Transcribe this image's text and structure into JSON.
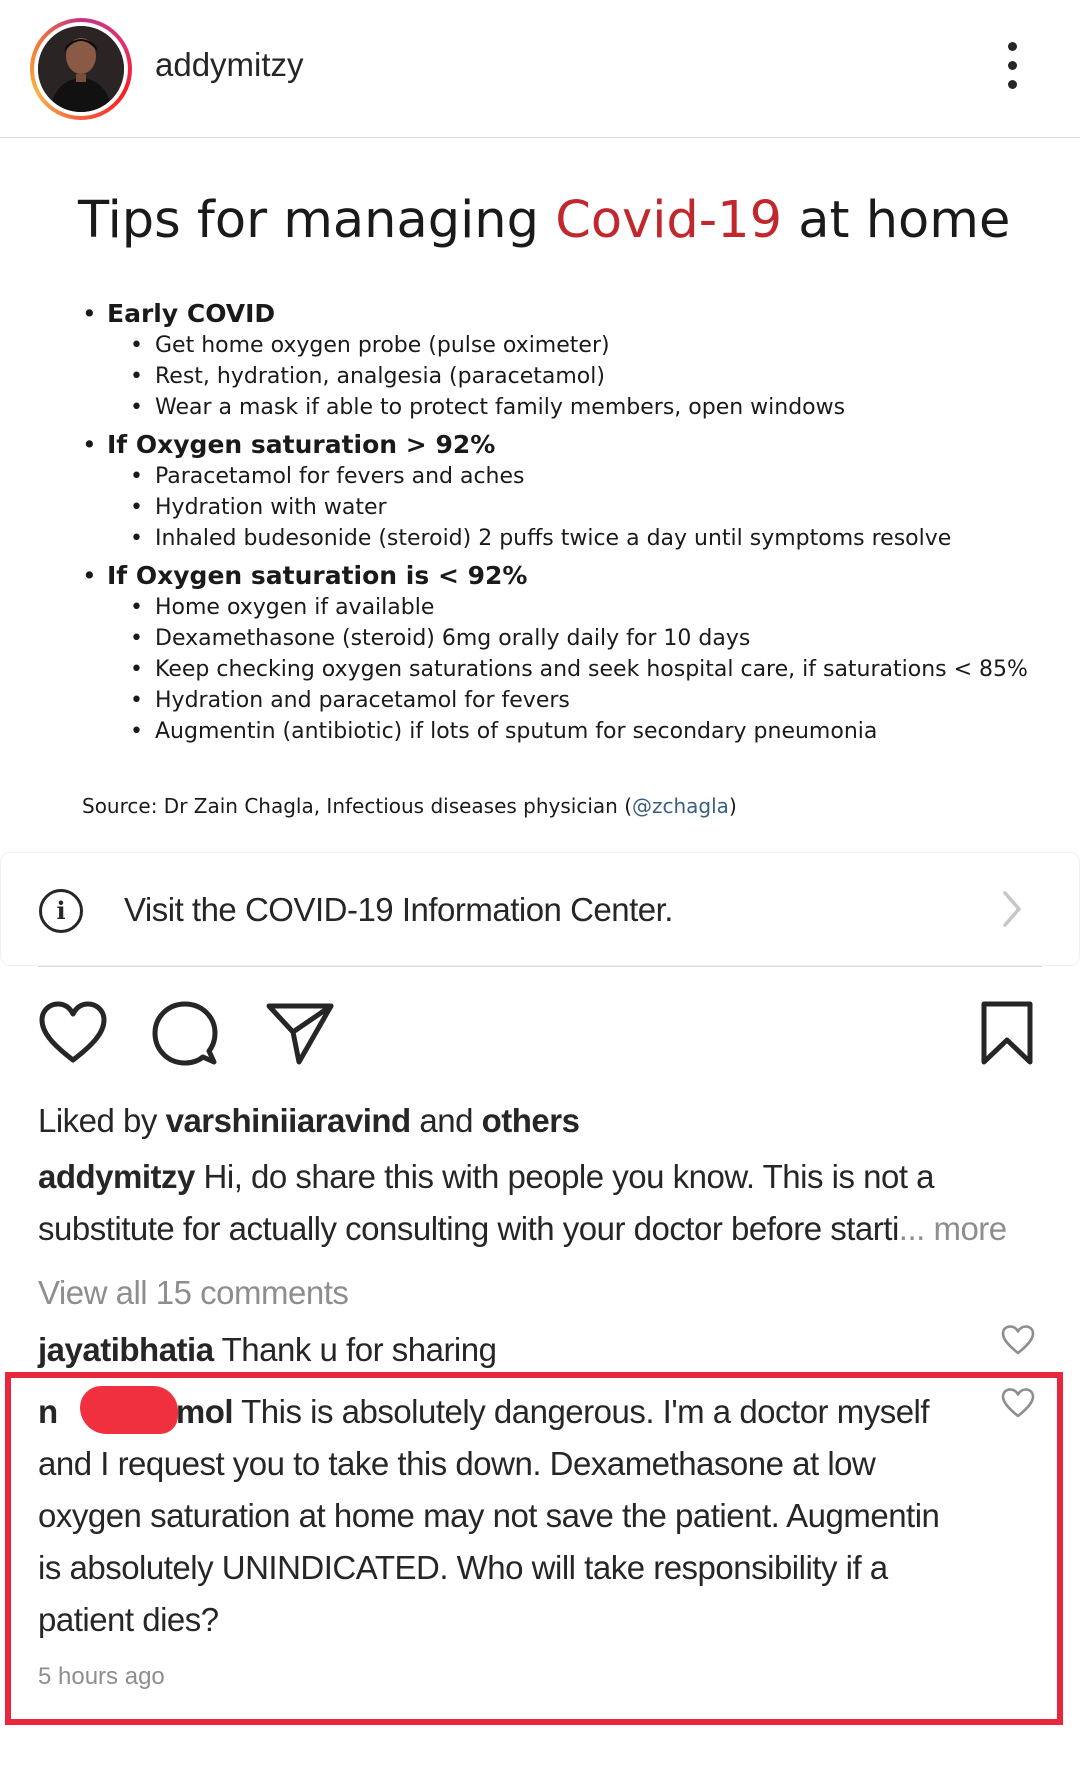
{
  "header": {
    "username": "addymitzy",
    "avatar_icon": "profile-photo",
    "more_icon": "more-vertical-icon"
  },
  "slide": {
    "title_pre": "Tips for managing ",
    "title_accent": "Covid-19",
    "title_post": " at home",
    "accent_color": "#c0282d",
    "groups": [
      {
        "heading": "Early COVID",
        "items": [
          "Get home oxygen probe (pulse oximeter)",
          "Rest, hydration, analgesia (paracetamol)",
          "Wear a mask if able to protect family members, open windows"
        ]
      },
      {
        "heading": "If Oxygen saturation > 92%",
        "items": [
          "Paracetamol for fevers and aches",
          "Hydration with water",
          "Inhaled budesonide (steroid) 2 puffs twice a day until symptoms resolve"
        ]
      },
      {
        "heading": "If Oxygen saturation is < 92%",
        "items": [
          "Home oxygen if available",
          "Dexamethasone (steroid) 6mg orally daily for 10 days",
          "Keep checking oxygen saturations and seek hospital care, if saturations < 85%",
          "Hydration and paracetamol for fevers",
          "Augmentin (antibiotic) if lots of sputum for secondary pneumonia"
        ]
      }
    ],
    "source_prefix": "Source: Dr Zain Chagla, Infectious diseases physician (",
    "source_handle": "@zchagla",
    "source_suffix": ")"
  },
  "info_banner": {
    "text": "Visit the COVID-19 Information Center.",
    "icon": "info-icon",
    "chevron_icon": "chevron-right-icon"
  },
  "actions": {
    "like_icon": "heart-icon",
    "comment_icon": "comment-icon",
    "share_icon": "send-icon",
    "save_icon": "bookmark-icon"
  },
  "likes": {
    "prefix": "Liked by ",
    "user": "varshiniiaravind",
    "middle": " and ",
    "others": "others"
  },
  "caption": {
    "username": "addymitzy",
    "line1": " Hi, do share this with people you know.  This is not a",
    "line2": "substitute for actually consulting with your doctor before starti",
    "ellipsis_more": "... more"
  },
  "view_all": "View all 15 comments",
  "comments": [
    {
      "username": "jayatibhatia",
      "text": " Thank u for sharing"
    },
    {
      "username_visible_start": "n",
      "username_visible_end": "mol",
      "lines": [
        " This is absolutely dangerous. I'm a doctor myself",
        "and I request you to take this down. Dexamethasone at low",
        "oxygen saturation at home may not save the patient. Augmentin",
        "is absolutely UNINDICATED. Who will take responsibility if a",
        "patient dies?"
      ],
      "timestamp": "5 hours ago",
      "highlight_color": "#e8263c"
    }
  ]
}
